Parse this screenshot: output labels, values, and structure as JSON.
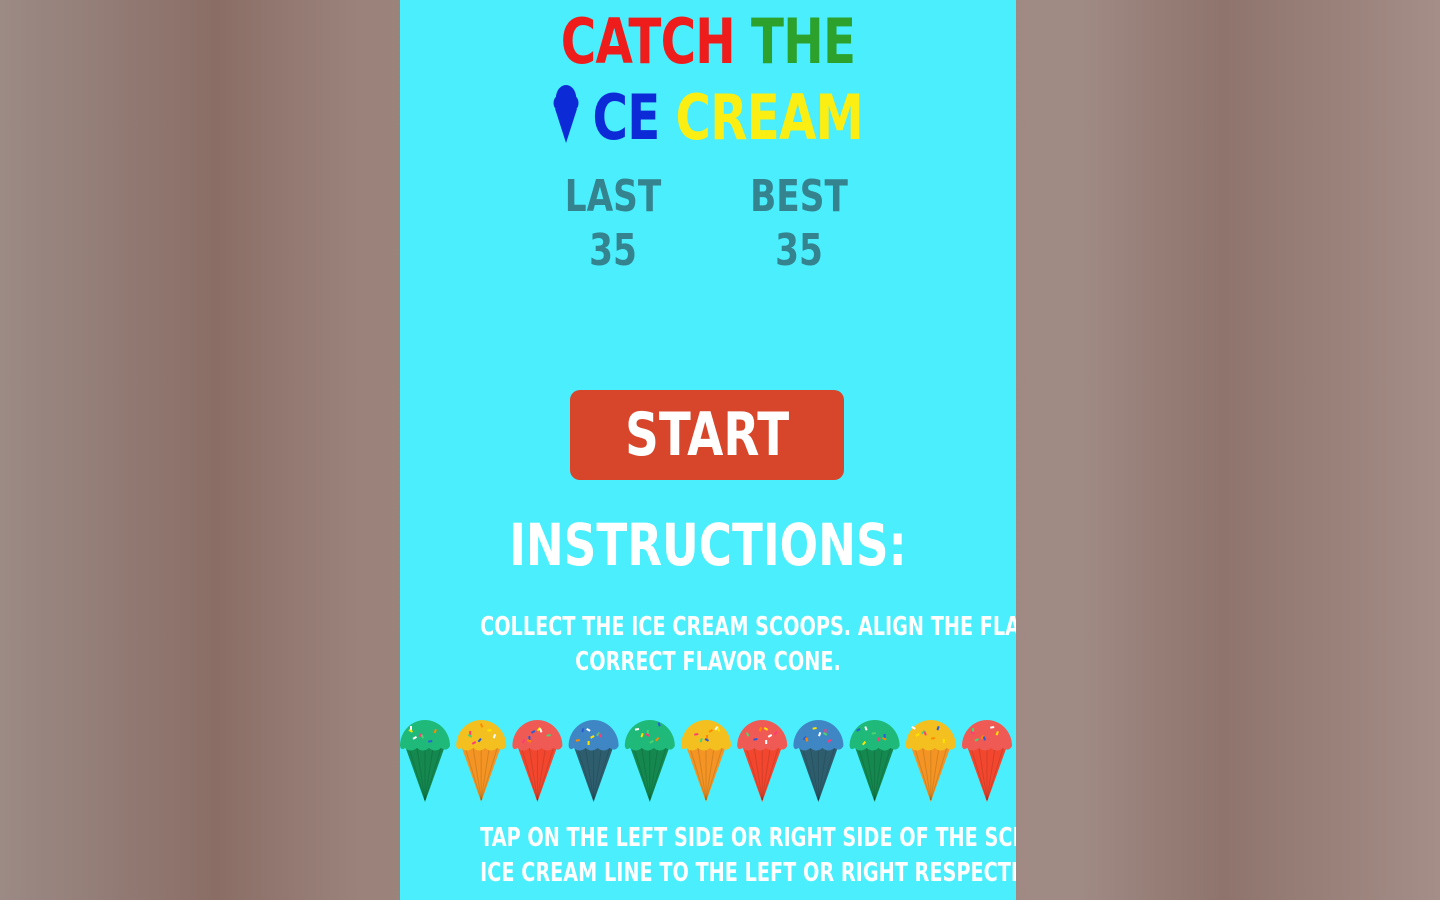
{
  "title": {
    "line1_word1": "CATCH",
    "line1_word2": "THE",
    "line2_word1": "CE",
    "line2_word2": "CREAM"
  },
  "scores": {
    "last_label": "LAST",
    "last_value": "35",
    "best_label": "BEST",
    "best_value": "35"
  },
  "start_label": "START",
  "instructions": {
    "heading": "INSTRUCTIONS:",
    "text1_line1": "COLLECT THE ICE CREAM SCOOPS. ALIGN THE FLAVORS WITH THE",
    "text1_line2": "CORRECT FLAVOR CONE.",
    "text2_line1": "TAP ON THE LEFT SIDE OR RIGHT SIDE OF THE SCREEN TO MOVE THE",
    "text2_line2": "ICE CREAM LINE TO THE LEFT OR RIGHT RESPECTIVELY"
  },
  "cones": [
    {
      "flavor": "mint",
      "scoop": "#1fb979",
      "cone": "#14884f"
    },
    {
      "flavor": "lemon",
      "scoop": "#f4c020",
      "cone": "#f39424"
    },
    {
      "flavor": "strawberry",
      "scoop": "#f05a55",
      "cone": "#f2472e"
    },
    {
      "flavor": "blueberry",
      "scoop": "#3f86c4",
      "cone": "#2e5e6e"
    },
    {
      "flavor": "mint",
      "scoop": "#1fb979",
      "cone": "#14884f"
    },
    {
      "flavor": "lemon",
      "scoop": "#f4c020",
      "cone": "#f39424"
    },
    {
      "flavor": "strawberry",
      "scoop": "#f05a55",
      "cone": "#f2472e"
    },
    {
      "flavor": "blueberry",
      "scoop": "#3f86c4",
      "cone": "#2e5e6e"
    },
    {
      "flavor": "mint",
      "scoop": "#1fb979",
      "cone": "#14884f"
    },
    {
      "flavor": "lemon",
      "scoop": "#f4c020",
      "cone": "#f39424"
    },
    {
      "flavor": "strawberry",
      "scoop": "#f05a55",
      "cone": "#f2472e"
    }
  ],
  "colors": {
    "background": "#4aeefc",
    "button": "#d7452a",
    "score_text": "#34838f"
  }
}
